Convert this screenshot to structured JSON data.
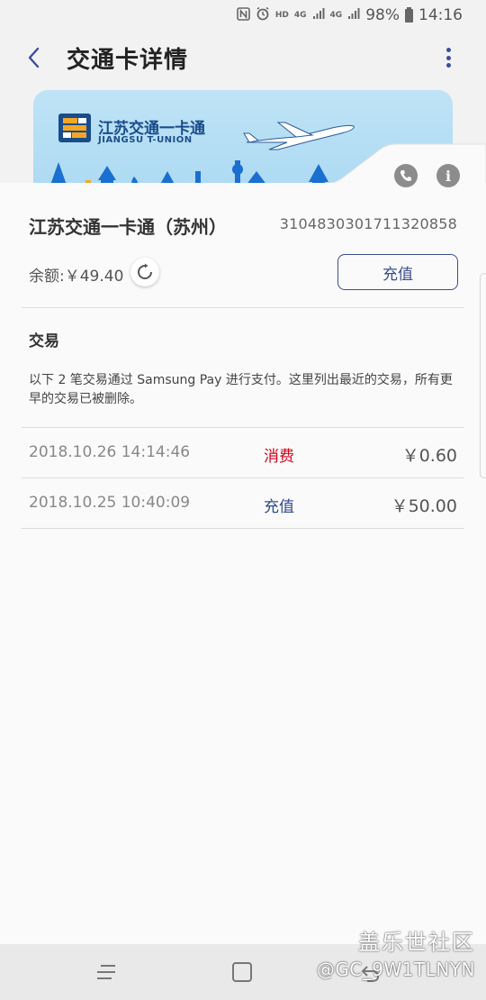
{
  "status_bar": {
    "hd": "HD",
    "net1": "4G",
    "net2": "4G",
    "battery": "98%",
    "time": "14:16",
    "icons": [
      "nfc-icon",
      "alarm-icon",
      "signal-icon",
      "battery-icon"
    ]
  },
  "header": {
    "title": "交通卡详情",
    "back_icon": "back-arrow-icon",
    "more_icon": "more-vertical-icon"
  },
  "card_image": {
    "name": "江苏交通一卡通",
    "name_en": "JIANGSU T-UNION"
  },
  "card": {
    "title": "江苏交通一卡通（苏州）",
    "number": "3104830301711320858",
    "balance_label": "余额:￥49.40",
    "recharge_label": "充值"
  },
  "transactions": {
    "section_title": "交易",
    "note": "以下 2 笔交易通过 Samsung Pay 进行支付。这里列出最近的交易，所有更早的交易已被删除。",
    "items": [
      {
        "date": "2018.10.26   14:14:46",
        "type": "消费",
        "amount": "￥0.60",
        "type_color": "#d0021b"
      },
      {
        "date": "2018.10.25   10:40:09",
        "type": "充值",
        "amount": "￥50.00",
        "type_color": "#2e4a8c"
      }
    ]
  },
  "watermark": {
    "brand": "盖乐世社区",
    "user": "@GC_9W1TLNYN"
  },
  "colors": {
    "accent": "#3a4f8a",
    "spend": "#d0021b",
    "recharge": "#2e4a8c"
  }
}
